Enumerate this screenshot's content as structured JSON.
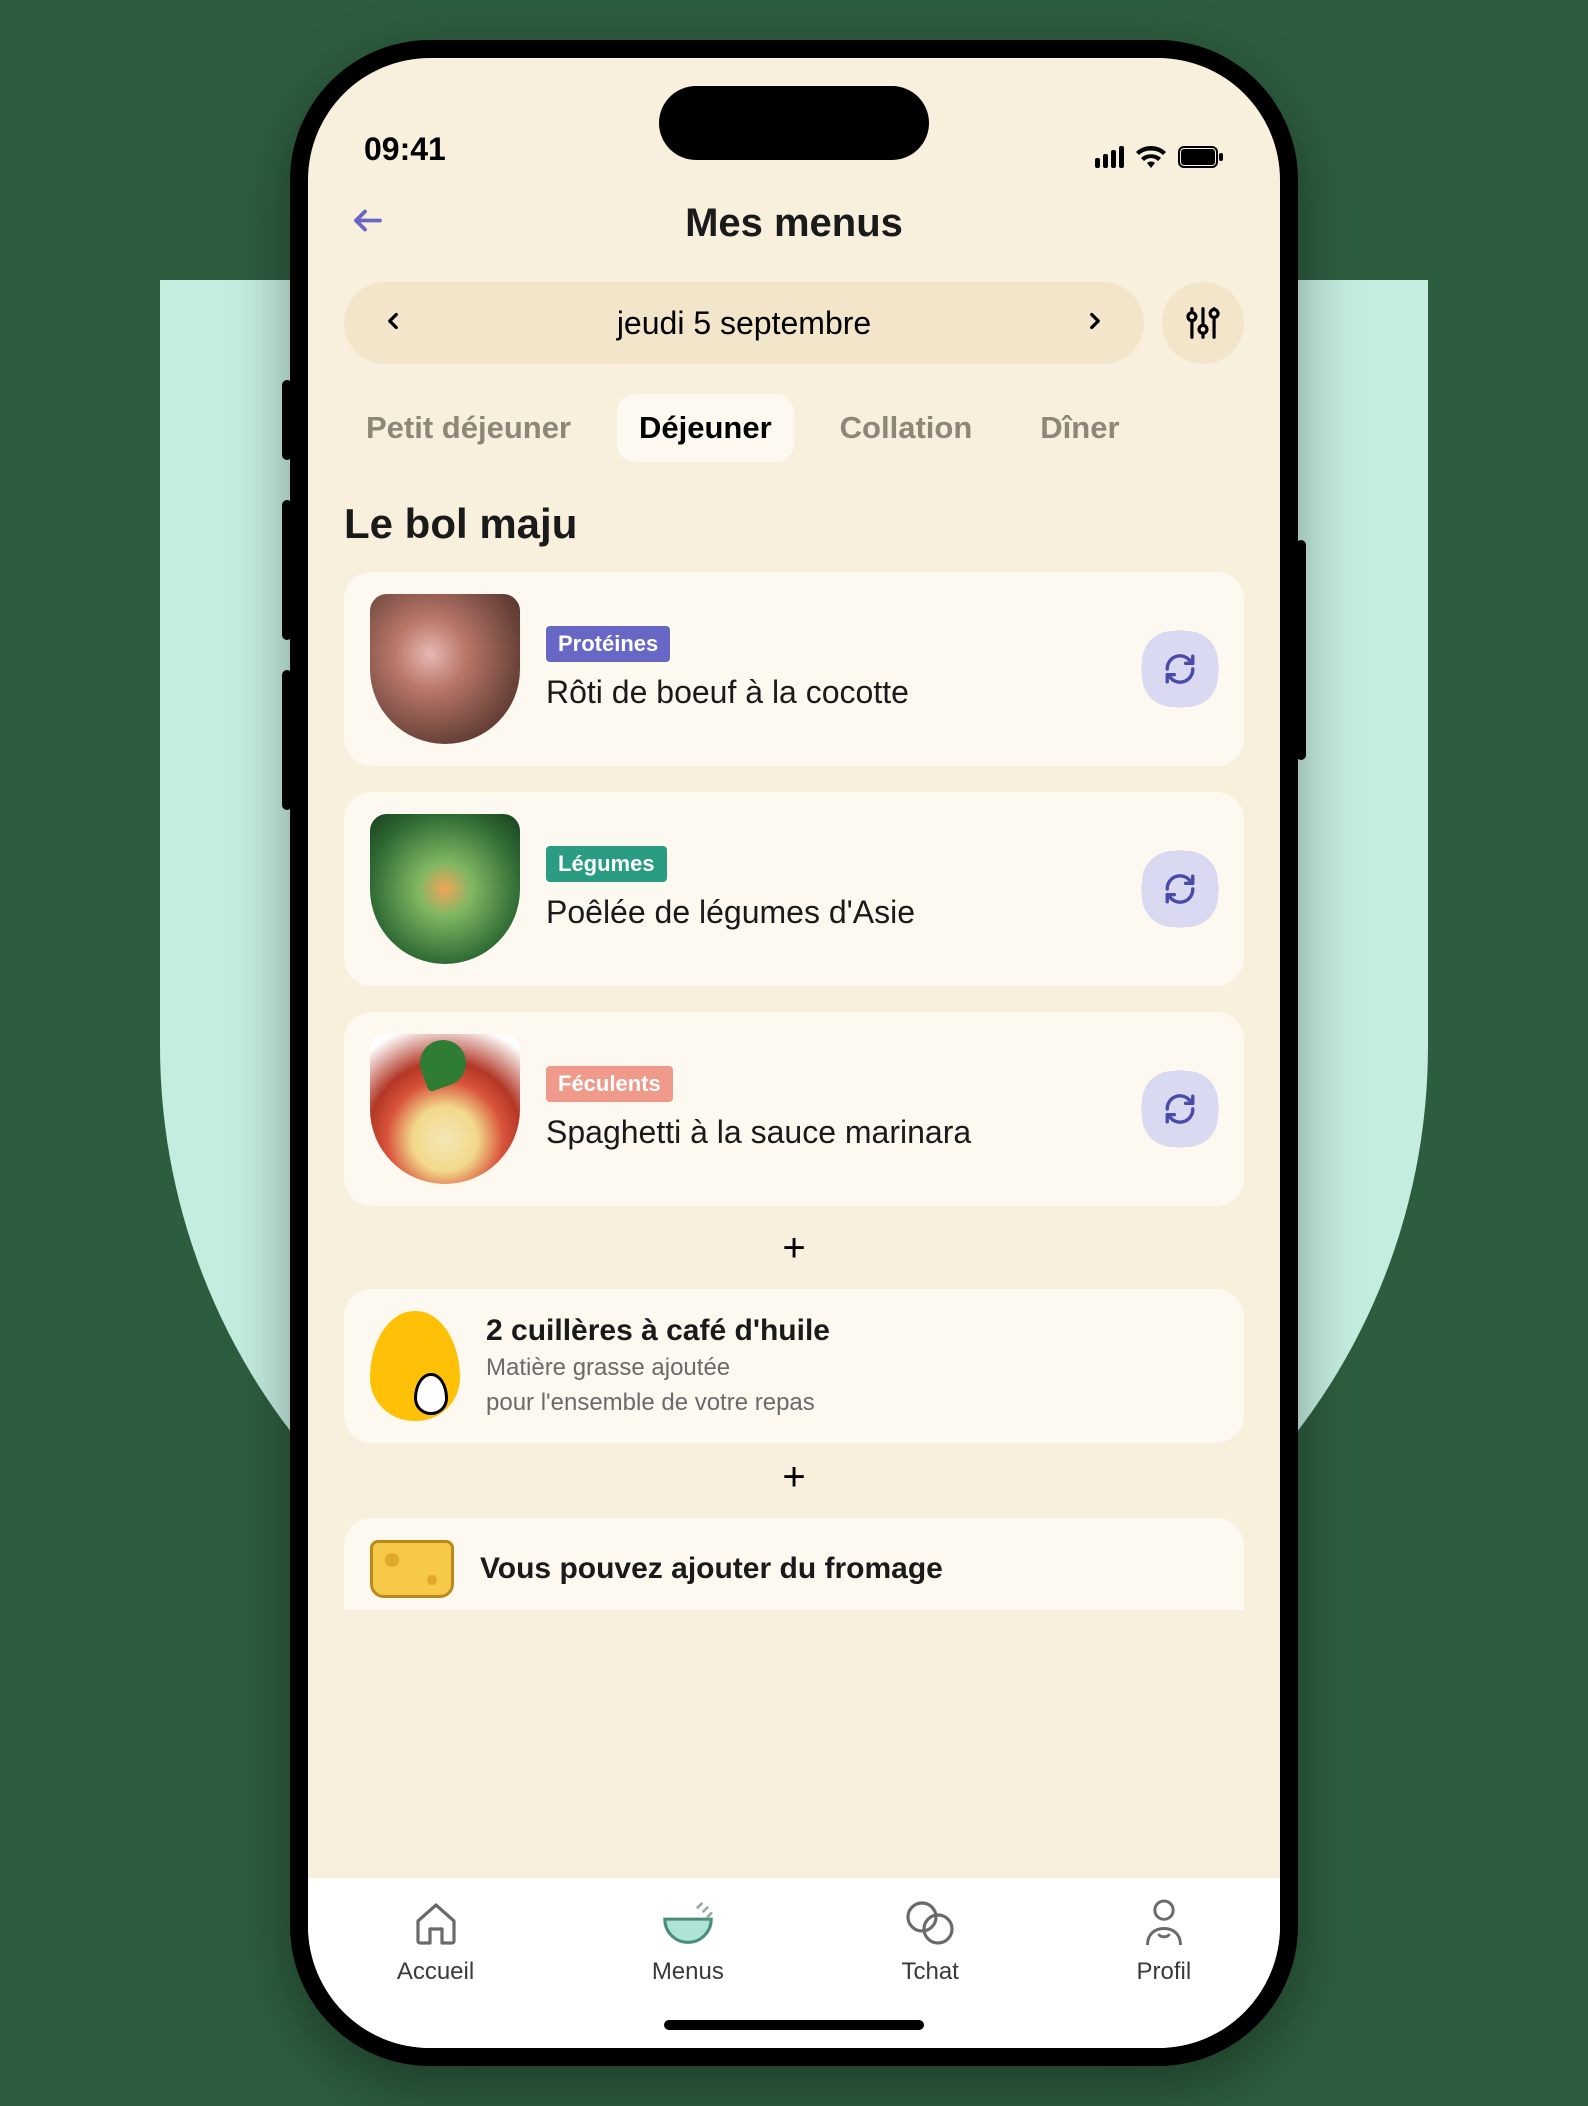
{
  "status": {
    "time": "09:41"
  },
  "header": {
    "title": "Mes menus"
  },
  "date": {
    "label": "jeudi 5 septembre"
  },
  "tabs": [
    {
      "label": "Petit déjeuner",
      "active": false
    },
    {
      "label": "Déjeuner",
      "active": true
    },
    {
      "label": "Collation",
      "active": false
    },
    {
      "label": "Dîner",
      "active": false
    }
  ],
  "section": {
    "title": "Le bol maju"
  },
  "cards": [
    {
      "badge": "Protéines",
      "badge_color": "#6767c5",
      "title": "Rôti de boeuf à la cocotte"
    },
    {
      "badge": "Légumes",
      "badge_color": "#2a9c82",
      "title": "Poêlée de légumes d'Asie"
    },
    {
      "badge": "Féculents",
      "badge_color": "#ef9a8b",
      "title": "Spaghetti à la sauce marinara"
    }
  ],
  "addons": {
    "oil": {
      "title": "2 cuillères à café d'huile",
      "sub1": "Matière grasse ajoutée",
      "sub2": "pour l'ensemble de votre repas"
    },
    "cheese": {
      "title": "Vous pouvez ajouter du fromage"
    }
  },
  "nav": [
    {
      "label": "Accueil"
    },
    {
      "label": "Menus"
    },
    {
      "label": "Tchat"
    },
    {
      "label": "Profil"
    }
  ]
}
